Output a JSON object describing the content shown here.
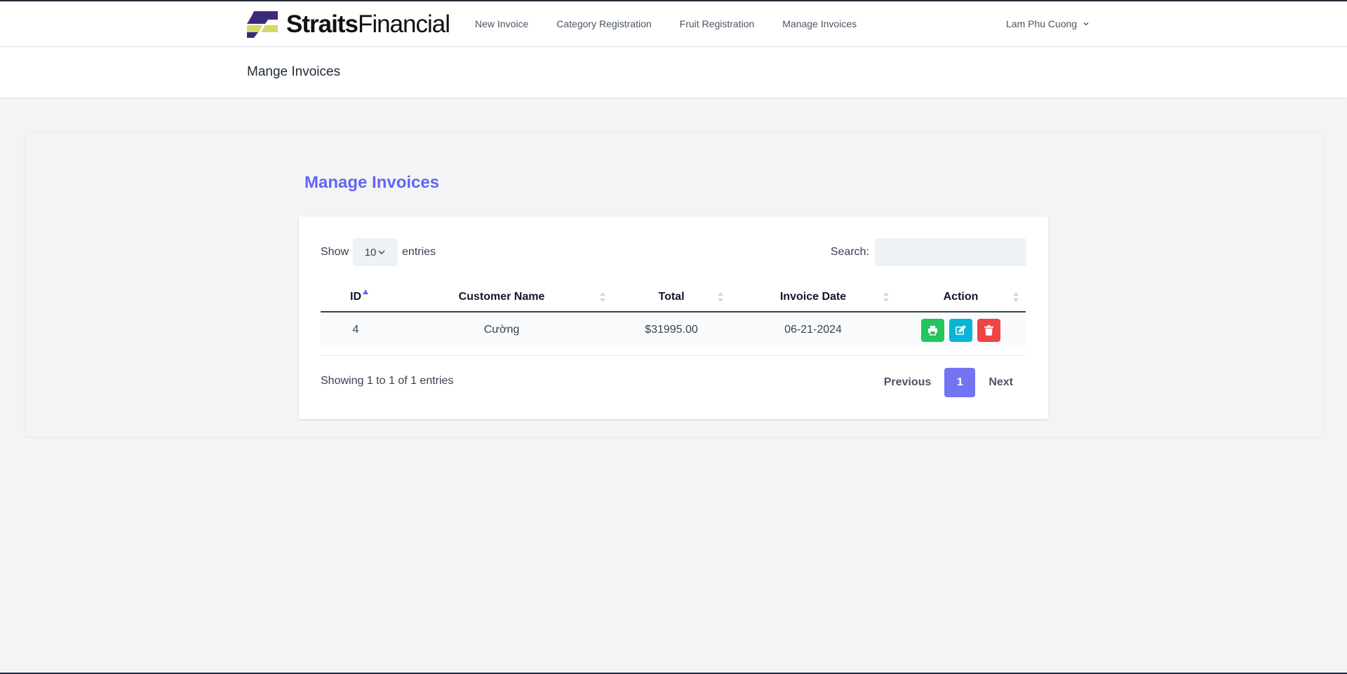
{
  "brand": {
    "bold": "Straits",
    "regular": "Financial"
  },
  "nav": {
    "items": [
      {
        "label": "New Invoice"
      },
      {
        "label": "Category Registration"
      },
      {
        "label": "Fruit Registration"
      },
      {
        "label": "Manage Invoices"
      }
    ],
    "user": "Lam Phu Cuong"
  },
  "header": {
    "title": "Mange Invoices"
  },
  "main": {
    "title": "Manage Invoices",
    "show_label": "Show",
    "page_length": "10",
    "entries_label": "entries",
    "search_label": "Search:",
    "search_value": "",
    "columns": [
      "ID",
      "Customer Name",
      "Total",
      "Invoice Date",
      "Action"
    ],
    "rows": [
      {
        "id": "4",
        "customer": "Cường",
        "total": "$31995.00",
        "date": "06-21-2024"
      }
    ],
    "info": "Showing 1 to 1 of 1 entries",
    "pagination": {
      "previous": "Previous",
      "current": "1",
      "next": "Next"
    }
  },
  "icons": {
    "print": "print-icon",
    "edit": "edit-icon",
    "delete": "trash-icon",
    "sort": "sort-icon",
    "chevron": "chevron-down-icon"
  },
  "colors": {
    "accent": "#6366f1",
    "print_button": "#22c55e",
    "edit_button": "#06b6d4",
    "delete_button": "#ef4444"
  }
}
